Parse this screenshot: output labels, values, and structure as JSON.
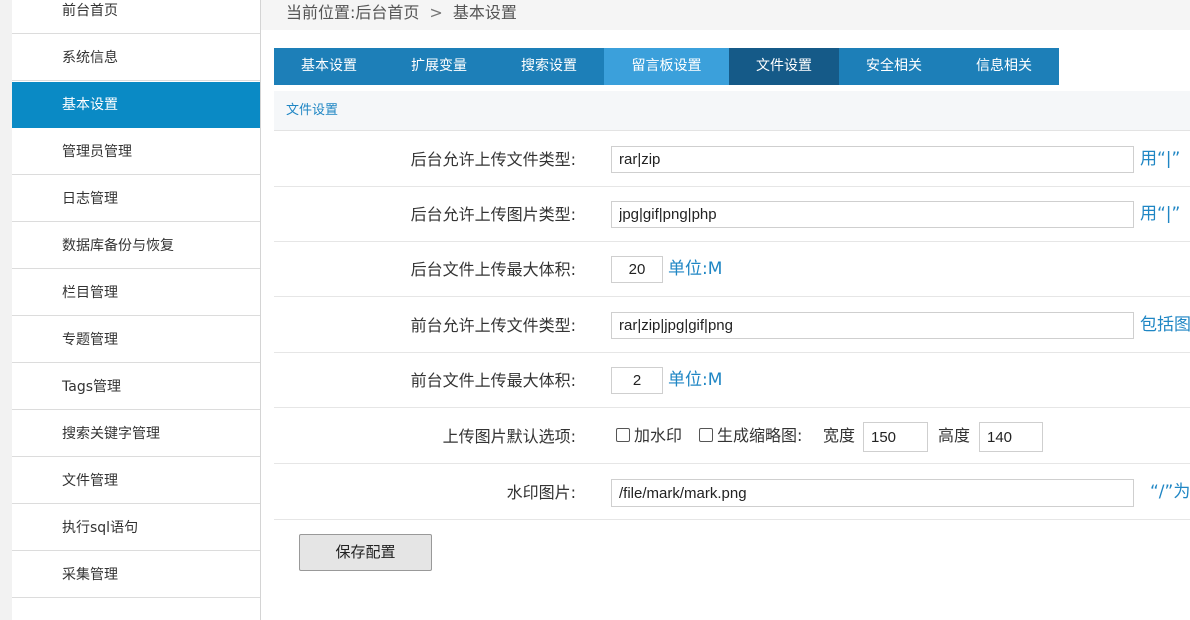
{
  "breadcrumb": {
    "prefix": "当前位置:",
    "home": "后台首页",
    "sep": ">",
    "current": "基本设置"
  },
  "sidebar": {
    "items": [
      {
        "label": "前台首页"
      },
      {
        "label": "系统信息"
      },
      {
        "label": "基本设置",
        "active": true
      },
      {
        "label": "管理员管理"
      },
      {
        "label": "日志管理"
      },
      {
        "label": "数据库备份与恢复"
      },
      {
        "label": "栏目管理"
      },
      {
        "label": "专题管理"
      },
      {
        "label": "Tags管理"
      },
      {
        "label": "搜索关键字管理"
      },
      {
        "label": "文件管理"
      },
      {
        "label": "执行sql语句"
      },
      {
        "label": "采集管理"
      }
    ]
  },
  "tabs": [
    {
      "label": "基本设置"
    },
    {
      "label": "扩展变量"
    },
    {
      "label": "搜索设置"
    },
    {
      "label": "留言板设置",
      "state": "hover"
    },
    {
      "label": "文件设置",
      "state": "active"
    },
    {
      "label": "安全相关"
    },
    {
      "label": "信息相关"
    }
  ],
  "section_title": "文件设置",
  "form": {
    "admin_file_types": {
      "label": "后台允许上传文件类型:",
      "value": "rar|zip",
      "hint": "用“|”"
    },
    "admin_image_types": {
      "label": "后台允许上传图片类型:",
      "value": "jpg|gif|png|php",
      "hint": "用“|”"
    },
    "admin_max_size": {
      "label": "后台文件上传最大体积:",
      "value": "20",
      "hint": "单位:M"
    },
    "front_file_types": {
      "label": "前台允许上传文件类型:",
      "value": "rar|zip|jpg|gif|png",
      "hint": "包括图"
    },
    "front_max_size": {
      "label": "前台文件上传最大体积:",
      "value": "2",
      "hint": "单位:M"
    },
    "image_defaults": {
      "label": "上传图片默认选项:",
      "watermark_label": "加水印",
      "watermark_checked": false,
      "thumb_label": "生成缩略图:",
      "thumb_checked": false,
      "width_label": "宽度",
      "width_value": "150",
      "height_label": "高度",
      "height_value": "140"
    },
    "watermark_image": {
      "label": "水印图片:",
      "value": "/file/mark/mark.png",
      "hint": "“/”为"
    }
  },
  "save_button": "保存配置",
  "colors": {
    "accent": "#0a8ac5",
    "tab": "#1d7fb8",
    "tab_hover": "#3ba0db",
    "tab_active": "#155a88",
    "hint": "#1f86c4"
  }
}
